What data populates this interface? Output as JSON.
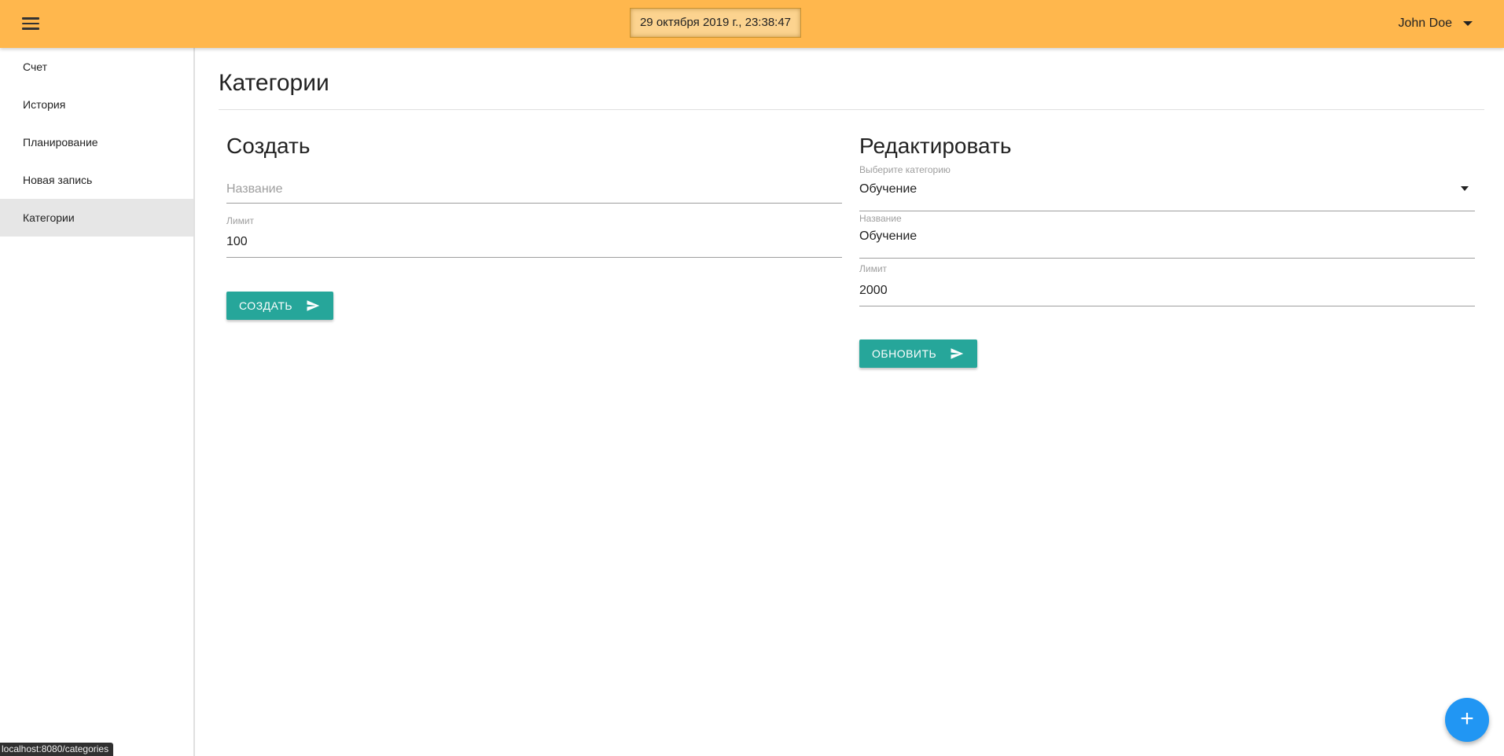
{
  "header": {
    "menu_icon": "hamburger-menu-icon",
    "datetime": "29 октября 2019 г., 23:38:47",
    "user_name": "John Doe",
    "accent_color": "#ffb74d"
  },
  "sidebar": {
    "items": [
      {
        "label": "Счет",
        "active": false
      },
      {
        "label": "История",
        "active": false
      },
      {
        "label": "Планирование",
        "active": false
      },
      {
        "label": "Новая запись",
        "active": false
      },
      {
        "label": "Категории",
        "active": true
      }
    ]
  },
  "main": {
    "title": "Категории",
    "create": {
      "title": "Создать",
      "name_placeholder": "Название",
      "limit_label": "Лимит",
      "limit_value": "100",
      "button_label": "СОЗДАТЬ",
      "button_icon": "send-icon"
    },
    "edit": {
      "title": "Редактировать",
      "select_label": "Выберите категорию",
      "select_value": "Обучение",
      "name_label": "Название",
      "name_value": "Обучение",
      "limit_label": "Лимит",
      "limit_value": "2000",
      "button_label": "ОБНОВИТЬ",
      "button_icon": "send-icon"
    }
  },
  "fab": {
    "label": "+",
    "color": "#2196f3"
  },
  "status_bar": {
    "url": "localhost:8080/categories"
  },
  "colors": {
    "button": "#26a69a"
  }
}
